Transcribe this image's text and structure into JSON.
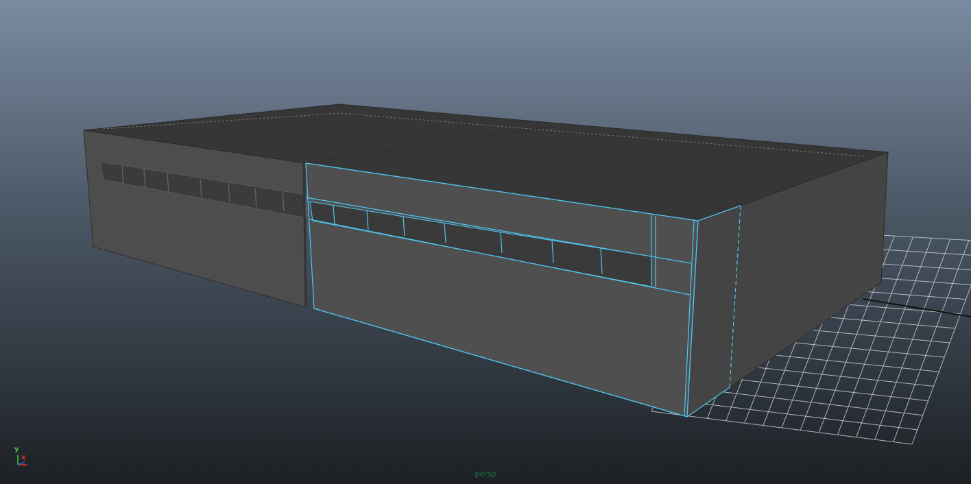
{
  "viewport": {
    "camera_name": "persp",
    "background_top_color": "#7a8ba1",
    "background_bottom_color": "#1f2327",
    "selection_color": "#4ec8f0",
    "grid_color": "#c9ced4"
  },
  "axis_gizmo": {
    "y_label": "y",
    "x_label": "x",
    "y_color": "#3ecf3e",
    "x_color": "#e03030",
    "z_color": "#3a5ae0"
  },
  "scene_objects": [
    {
      "name": "building-roof",
      "selected": false
    },
    {
      "name": "building-front-left-wall",
      "selected": false
    },
    {
      "name": "building-front-right-wall",
      "selected": true
    },
    {
      "name": "building-side-wall",
      "selected": false
    },
    {
      "name": "front-windows-left",
      "selected": false
    },
    {
      "name": "front-windows-right",
      "selected": true
    }
  ],
  "grid": {
    "visible": true
  }
}
